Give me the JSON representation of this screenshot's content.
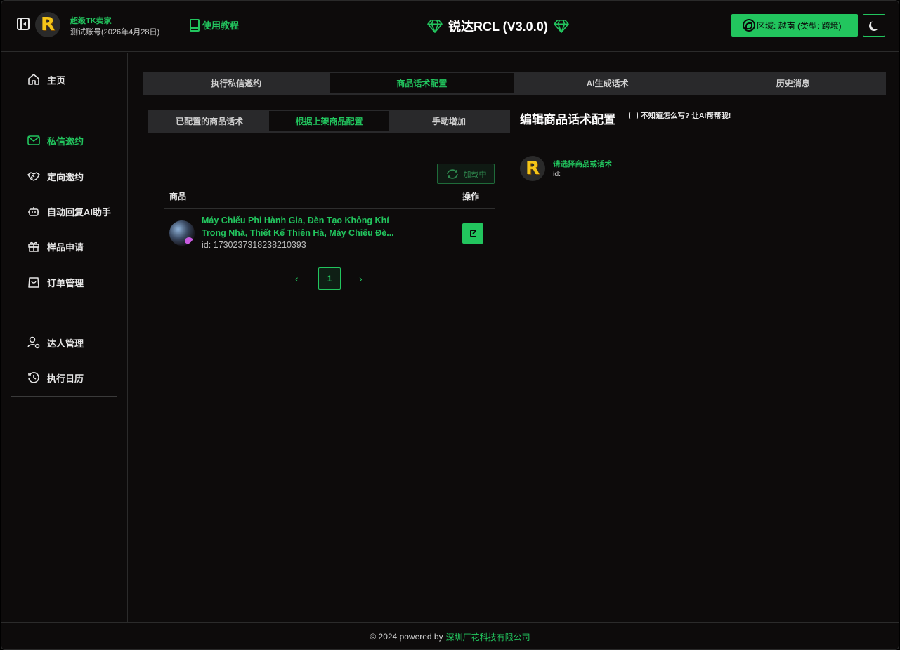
{
  "header": {
    "brand_title": "超级TK卖家",
    "brand_sub": "测试账号(2026年4月28日)",
    "logo_letter": "R",
    "tutorial": "使用教程",
    "app_title": "锐达RCL (V3.0.0)",
    "region": "区域: 越南 (类型: 跨境)"
  },
  "sidebar": {
    "items": [
      {
        "label": "主页",
        "icon": "home-icon"
      },
      {
        "label": "私信邀约",
        "icon": "mail-icon",
        "active": true
      },
      {
        "label": "定向邀约",
        "icon": "handshake-icon"
      },
      {
        "label": "自动回复AI助手",
        "icon": "bot-icon"
      },
      {
        "label": "样品申请",
        "icon": "gift-icon"
      },
      {
        "label": "订单管理",
        "icon": "bag-icon"
      },
      {
        "label": "达人管理",
        "icon": "user-gear-icon"
      },
      {
        "label": "执行日历",
        "icon": "history-icon"
      }
    ]
  },
  "main_tabs": [
    "执行私信邀约",
    "商品话术配置",
    "AI生成话术",
    "历史消息"
  ],
  "sub_tabs": [
    "已配置的商品话术",
    "根据上架商品配置",
    "手动增加"
  ],
  "product_list": {
    "loading_label": "加载中",
    "columns": [
      "商品",
      "操作"
    ],
    "rows": [
      {
        "name": "Máy Chiếu Phi Hành Gia, Đèn Tạo Không Khí Trong Nhà, Thiết Kế Thiên Hà, Máy Chiếu Đè...",
        "id": "id: 1730237318238210393"
      }
    ],
    "pager": {
      "prev": "‹",
      "page": "1",
      "next": "›"
    }
  },
  "editor": {
    "title": "编辑商品话术配置",
    "ai_help": "不知道怎么写? 让AI帮帮我!",
    "placeholder_title": "请选择商品或话术",
    "placeholder_id": "id:"
  },
  "footer": {
    "prefix": "© 2024 powered by",
    "company": "深圳厂花科技有限公司"
  },
  "colors": {
    "accent": "#22c55e",
    "background": "#0d0b0b"
  }
}
